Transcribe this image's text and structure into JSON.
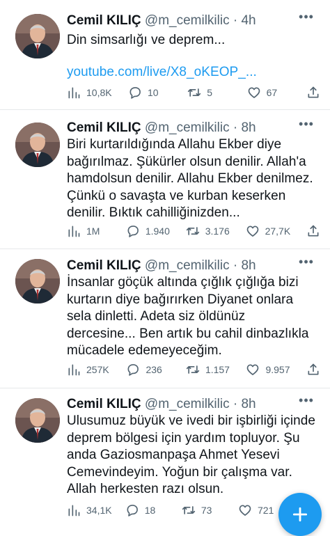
{
  "tweets": [
    {
      "name": "Cemil KILIÇ",
      "handle": "@m_cemilkilic · 4h",
      "text": "Din simsarlığı ve deprem...",
      "link": "youtube.com/live/X8_oKEOP_...",
      "views": "10,8K",
      "replies": "10",
      "retweets": "5",
      "likes": "67"
    },
    {
      "name": "Cemil KILIÇ",
      "handle": "@m_cemilkilic · 8h",
      "text": "Biri kurtarıldığında Allahu Ekber diye\nbağırılmaz. Şükürler olsun denilir. Allah'a\nhamdolsun denilir. Allahu Ekber denilmez.\nÇünkü o savaşta ve kurban keserken\ndenilir. Bıktık cahilliğinizden...",
      "views": "1M",
      "replies": "1.940",
      "retweets": "3.176",
      "likes": "27,7K"
    },
    {
      "name": "Cemil KILIÇ",
      "handle": "@m_cemilkilic · 8h",
      "text": "İnsanlar göçük altında çığlık çığlığa bizi\nkurtarın diye bağırırken Diyanet onlara\nsela dinletti. Adeta siz öldünüz\ndercesine... Ben artık bu cahil dinbazlıkla\nmücadele edemeyeceğim.",
      "views": "257K",
      "replies": "236",
      "retweets": "1.157",
      "likes": "9.957"
    },
    {
      "name": "Cemil KILIÇ",
      "handle": "@m_cemilkilic · 8h",
      "text": "Ulusumuz büyük ve ivedi bir işbirliği içinde\ndeprem bölgesi için yardım topluyor. Şu\nanda Gaziosmanpaşa Ahmet Yesevi\nCemevindeyim. Yoğun bir çalışma var.\nAllah herkesten razı olsun.",
      "views": "34,1K",
      "replies": "18",
      "retweets": "73",
      "likes": "721"
    }
  ],
  "colors": {
    "accent": "#1d9bf0",
    "muted": "#536471",
    "text": "#0f1419",
    "divider": "#e6e8ea"
  },
  "icons": {
    "views": "bar-chart-icon",
    "replies": "comment-icon",
    "retweets": "retweet-icon",
    "likes": "heart-icon",
    "share": "share-icon",
    "more": "more-dots-icon",
    "compose": "plus-icon"
  }
}
